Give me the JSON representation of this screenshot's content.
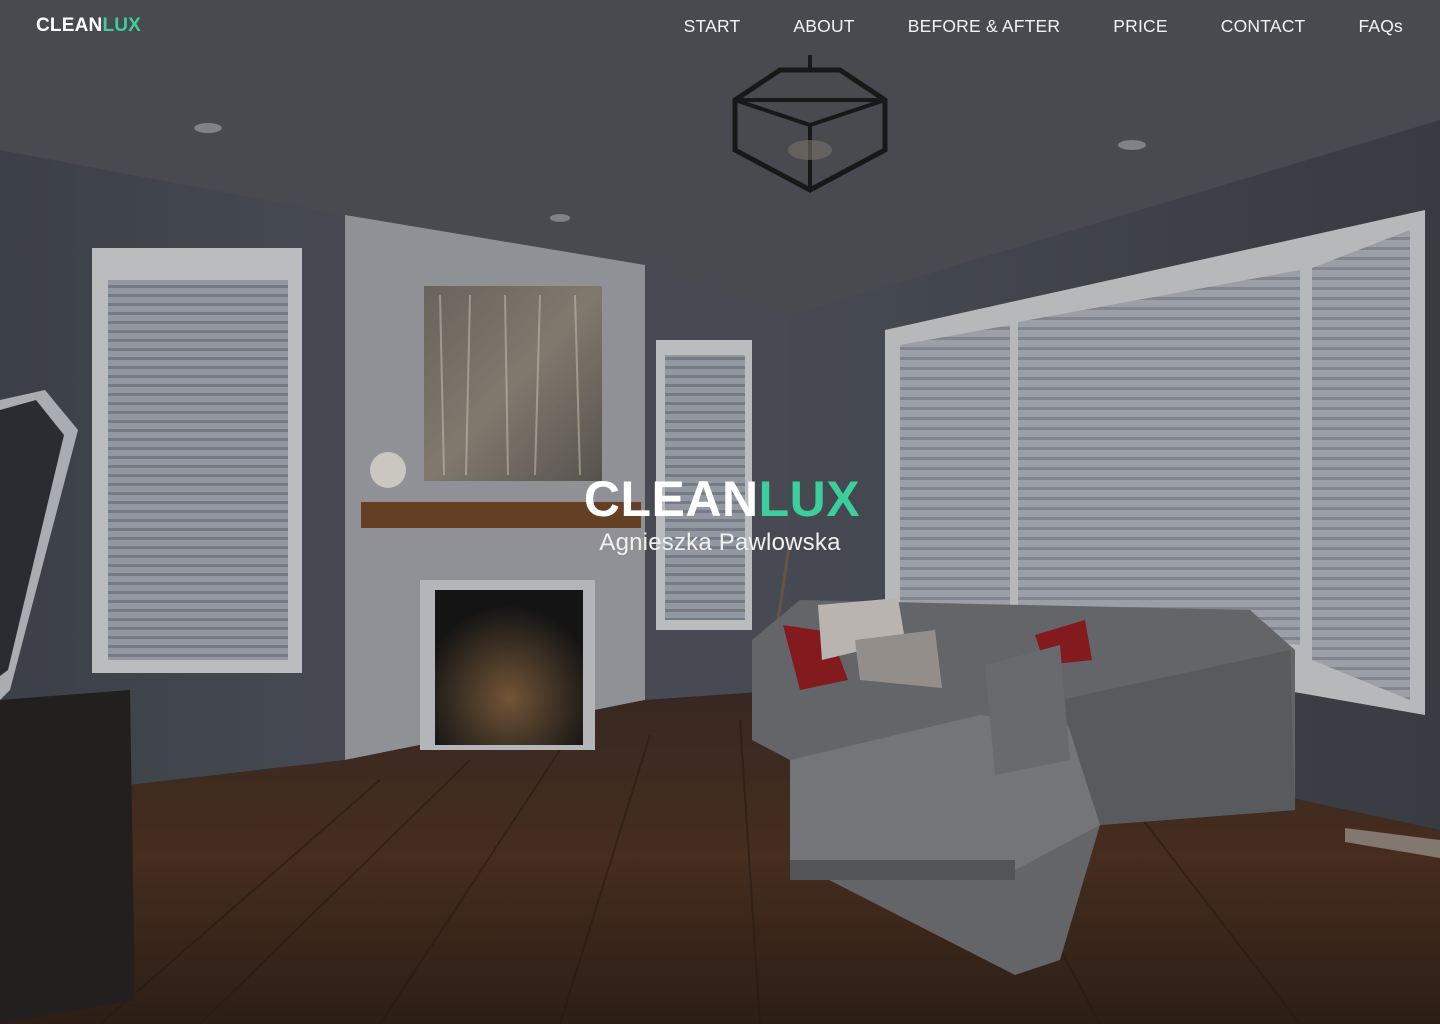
{
  "header": {
    "logo": {
      "part1": "CLEAN",
      "part2": "LUX"
    },
    "nav": [
      {
        "label": "START"
      },
      {
        "label": "ABOUT"
      },
      {
        "label": "BEFORE & AFTER"
      },
      {
        "label": "PRICE"
      },
      {
        "label": "CONTACT"
      },
      {
        "label": "FAQs"
      }
    ]
  },
  "hero": {
    "title": {
      "part1": "CLEAN",
      "part2": "LUX"
    },
    "subtitle": "Agnieszka Pawlowska",
    "background": "living-room-photo"
  },
  "colors": {
    "accent": "#3ccf9b",
    "text": "#ffffff"
  }
}
